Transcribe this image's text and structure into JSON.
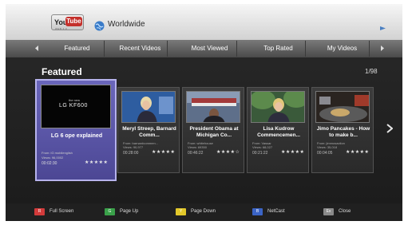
{
  "header": {
    "logo_you": "You",
    "logo_tube": "Tube",
    "logo_sub": "WEB 2.0",
    "region": "Worldwide"
  },
  "tabs": [
    {
      "label": "Featured"
    },
    {
      "label": "Recent Videos"
    },
    {
      "label": "Most Viewed"
    },
    {
      "label": "Top Rated"
    },
    {
      "label": "My Videos"
    }
  ],
  "section": {
    "title": "Featured",
    "page": "1/98"
  },
  "videos": [
    {
      "title": "LG 6 ope explained",
      "thumb_text": "LG KF600",
      "thumb_small": "the new",
      "from": "From: lG mobilenglish",
      "views": "Views: 96,0002",
      "duration": "00:02:30",
      "stars": "★★★★★"
    },
    {
      "title": "Meryl Streep, Barnard Comm...",
      "from": "From: barnardcommen...",
      "views": "Views: 90,977",
      "duration": "00:28:00",
      "stars": "★★★★★"
    },
    {
      "title": "President Obama at Michigan Co...",
      "from": "From: whitehouse",
      "views": "Views: 69350",
      "duration": "00:46:22",
      "stars": "★★★★☆"
    },
    {
      "title": "Lisa Kudrow Commencemen...",
      "from": "From: Vassar",
      "views": "Views: 68,027",
      "duration": "00:21:22",
      "stars": "★★★★★"
    },
    {
      "title": "Jimo Pancakes - How to make b...",
      "from": "From: jimmosaction",
      "views": "Views: 35,018",
      "duration": "00:04:05",
      "stars": "★★★★★"
    }
  ],
  "footer": [
    {
      "label": "Full Screen",
      "key": "R",
      "color": "#d23b3b"
    },
    {
      "label": "Page Up",
      "key": "G",
      "color": "#3aa14a"
    },
    {
      "label": "Page Down",
      "key": "Y",
      "color": "#e2c82a"
    },
    {
      "label": "NetCast",
      "key": "B",
      "color": "#3b64c6"
    },
    {
      "label": "Close",
      "key": "Ex",
      "color": "#8a8a8a"
    }
  ]
}
